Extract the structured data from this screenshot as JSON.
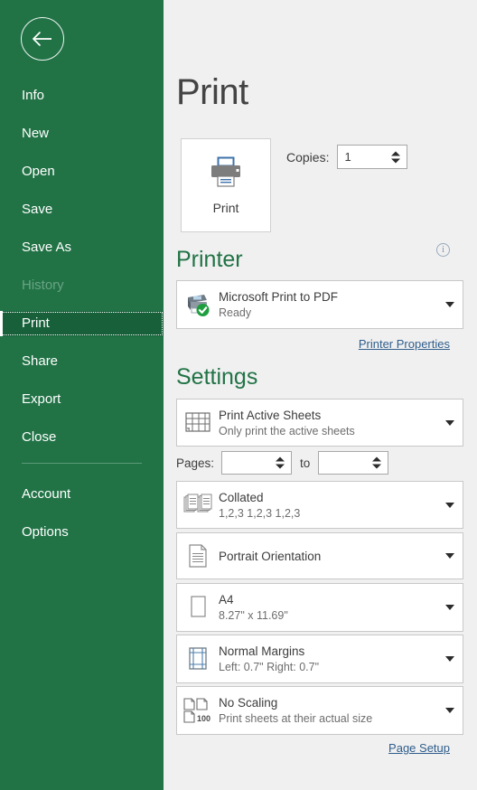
{
  "app": {
    "accent_green": "#217346",
    "background": "#f0f0f0",
    "link_color": "#2f5d8c"
  },
  "sidebar": {
    "back_icon": "back-arrow-icon",
    "items": [
      {
        "label": "Info",
        "state": "normal"
      },
      {
        "label": "New",
        "state": "normal"
      },
      {
        "label": "Open",
        "state": "normal"
      },
      {
        "label": "Save",
        "state": "normal"
      },
      {
        "label": "Save As",
        "state": "normal"
      },
      {
        "label": "History",
        "state": "disabled"
      },
      {
        "label": "Print",
        "state": "active"
      },
      {
        "label": "Share",
        "state": "normal"
      },
      {
        "label": "Export",
        "state": "normal"
      },
      {
        "label": "Close",
        "state": "normal"
      },
      {
        "label": "Account",
        "state": "normal"
      },
      {
        "label": "Options",
        "state": "normal"
      }
    ]
  },
  "main": {
    "page_title": "Print",
    "print_button": {
      "label": "Print",
      "icon": "printer-icon"
    },
    "copies": {
      "label": "Copies:",
      "value": "1"
    },
    "printer_section": {
      "heading": "Printer",
      "info_icon": "info-icon",
      "selected": {
        "name": "Microsoft Print to PDF",
        "status": "Ready",
        "icon": "printer-ready-icon"
      },
      "properties_link": "Printer Properties"
    },
    "settings_section": {
      "heading": "Settings",
      "print_what": {
        "title": "Print Active Sheets",
        "subtitle": "Only print the active sheets",
        "icon": "worksheet-grid-icon"
      },
      "pages": {
        "label": "Pages:",
        "from_value": "",
        "to_label": "to",
        "to_value": ""
      },
      "collation": {
        "title": "Collated",
        "subtitle": "1,2,3   1,2,3   1,2,3",
        "icon": "collated-documents-icon"
      },
      "orientation": {
        "title": "Portrait Orientation",
        "subtitle": "",
        "icon": "portrait-page-icon"
      },
      "paper_size": {
        "title": "A4",
        "subtitle": "8.27\" x 11.69\"",
        "icon": "paper-size-icon"
      },
      "margins": {
        "title": "Normal Margins",
        "subtitle": "Left:  0.7\"   Right:  0.7\"",
        "icon": "margins-icon"
      },
      "scaling": {
        "title": "No Scaling",
        "subtitle": "Print sheets at their actual size",
        "icon": "scaling-icon",
        "icon_badge": "100"
      },
      "page_setup_link": "Page Setup"
    }
  }
}
